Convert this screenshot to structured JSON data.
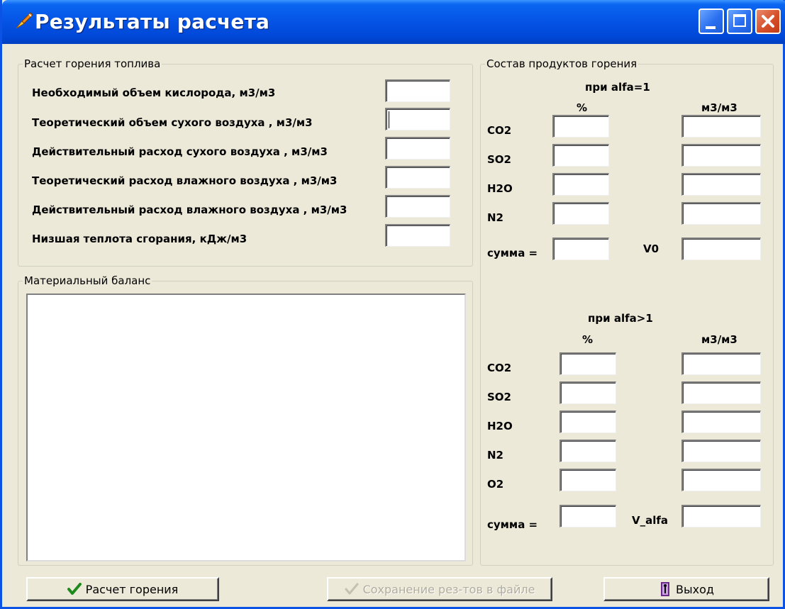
{
  "window": {
    "title": "Результаты расчета"
  },
  "fuel_group": {
    "title": "Расчет горения топлива",
    "rows": [
      {
        "label": "Необходимый объем кислорода, м3/м3",
        "value": ""
      },
      {
        "label": "Теоретический объем сухого воздуха , м3/м3",
        "value": ""
      },
      {
        "label": "Действительный расход сухого воздуха , м3/м3",
        "value": ""
      },
      {
        "label": "Теоретический расход влажного воздуха , м3/м3",
        "value": ""
      },
      {
        "label": "Действительный расход влажного воздуха , м3/м3",
        "value": ""
      },
      {
        "label": "Низшая теплота сгорания, кДж/м3",
        "value": ""
      }
    ]
  },
  "balance_group": {
    "title": "Материальный баланс",
    "memo_text": ""
  },
  "products_group": {
    "title": "Состав продуктов горения",
    "alfa1": {
      "heading": "при alfa=1",
      "col_percent": "%",
      "col_volume": "м3/м3",
      "rows": [
        "CO2",
        "SO2",
        "H2O",
        "N2"
      ],
      "sum_label": "сумма =",
      "total_label": "V0"
    },
    "alfa_gt1": {
      "heading": "при alfa>1",
      "col_percent": "%",
      "col_volume": "м3/м3",
      "rows": [
        "CO2",
        "SO2",
        "H2O",
        "N2",
        "O2"
      ],
      "sum_label": "сумма =",
      "total_label": "V_alfa"
    }
  },
  "buttons": {
    "calc": "Расчет горения",
    "save": "Сохранение рез-тов в файле",
    "exit": "Выход"
  },
  "colors": {
    "titlebar": "#0553e5",
    "face": "#ece9d8",
    "close": "#d6502a"
  }
}
